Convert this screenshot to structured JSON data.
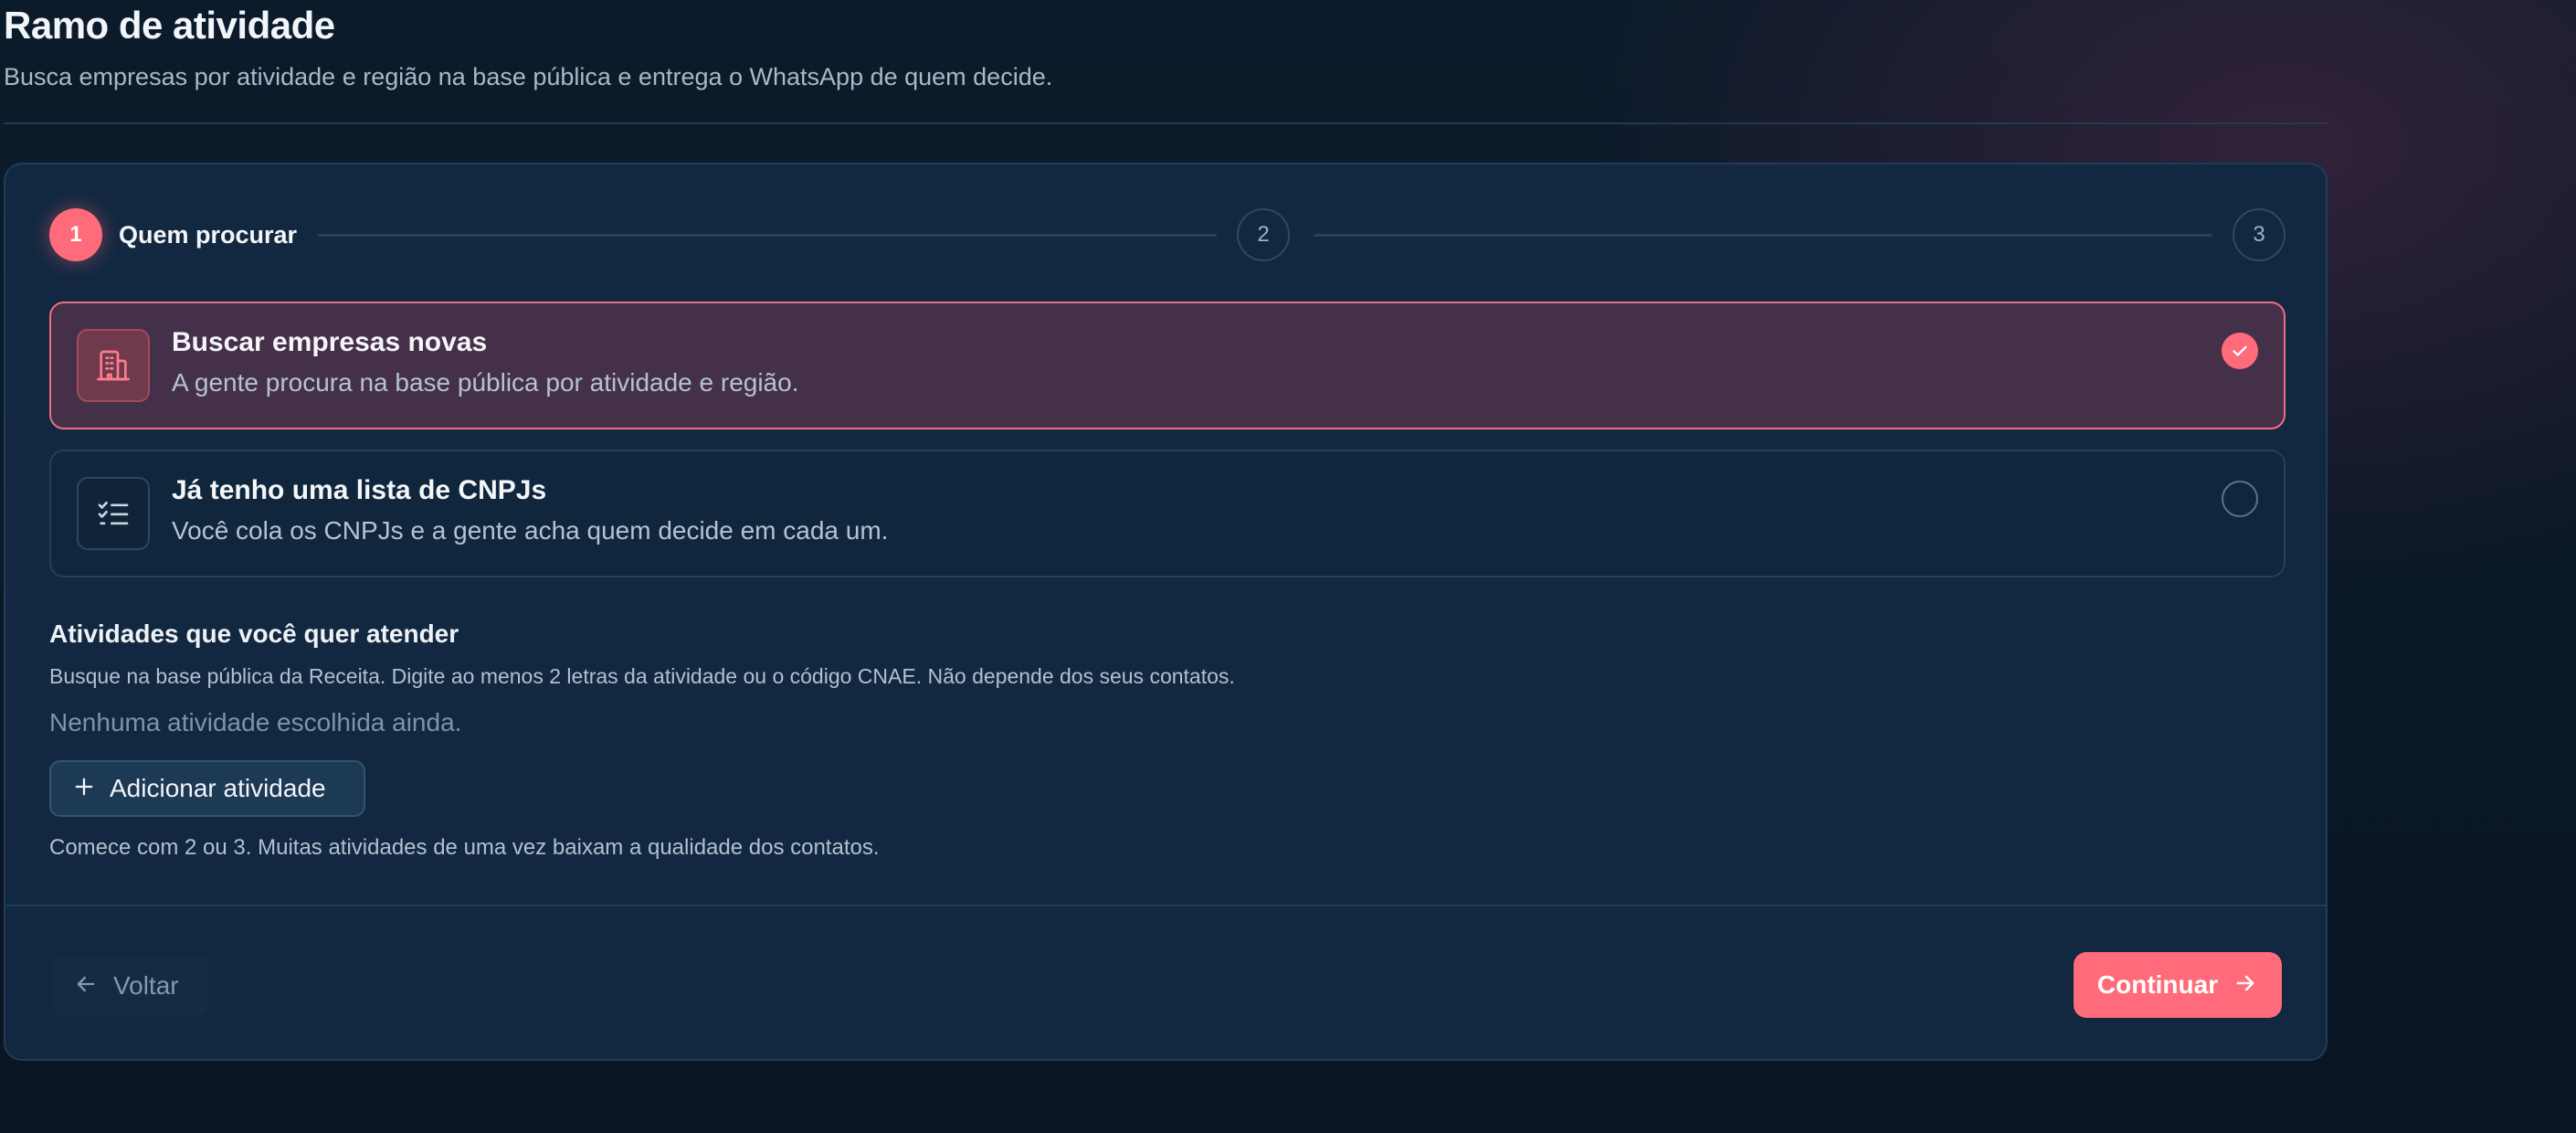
{
  "header": {
    "title": "Ramo de atividade",
    "subtitle": "Busca empresas por atividade e região na base pública e entrega o WhatsApp de quem decide."
  },
  "stepper": {
    "steps": [
      {
        "number": "1",
        "label": "Quem procurar",
        "state": "active"
      },
      {
        "number": "2",
        "label": "",
        "state": "pending"
      },
      {
        "number": "3",
        "label": "",
        "state": "pending"
      }
    ]
  },
  "options": [
    {
      "title": "Buscar empresas novas",
      "description": "A gente procura na base pública por atividade e região.",
      "icon": "building-icon",
      "selected": true
    },
    {
      "title": "Já tenho uma lista de CNPJs",
      "description": "Você cola os CNPJs e a gente acha quem decide em cada um.",
      "icon": "checklist-icon",
      "selected": false
    }
  ],
  "activities": {
    "title": "Atividades que você quer atender",
    "help": "Busque na base pública da Receita. Digite ao menos 2 letras da atividade ou o código CNAE. Não depende dos seus contatos.",
    "empty": "Nenhuma atividade escolhida ainda.",
    "add_label": "Adicionar atividade",
    "tip": "Comece com 2 ou 3. Muitas atividades de uma vez baixam a qualidade dos contatos."
  },
  "footer": {
    "back_label": "Voltar",
    "continue_label": "Continuar"
  },
  "colors": {
    "accent": "#ff6b7a",
    "background": "#0c1b2b",
    "card": "#112840",
    "selected_option": "#45304a"
  }
}
